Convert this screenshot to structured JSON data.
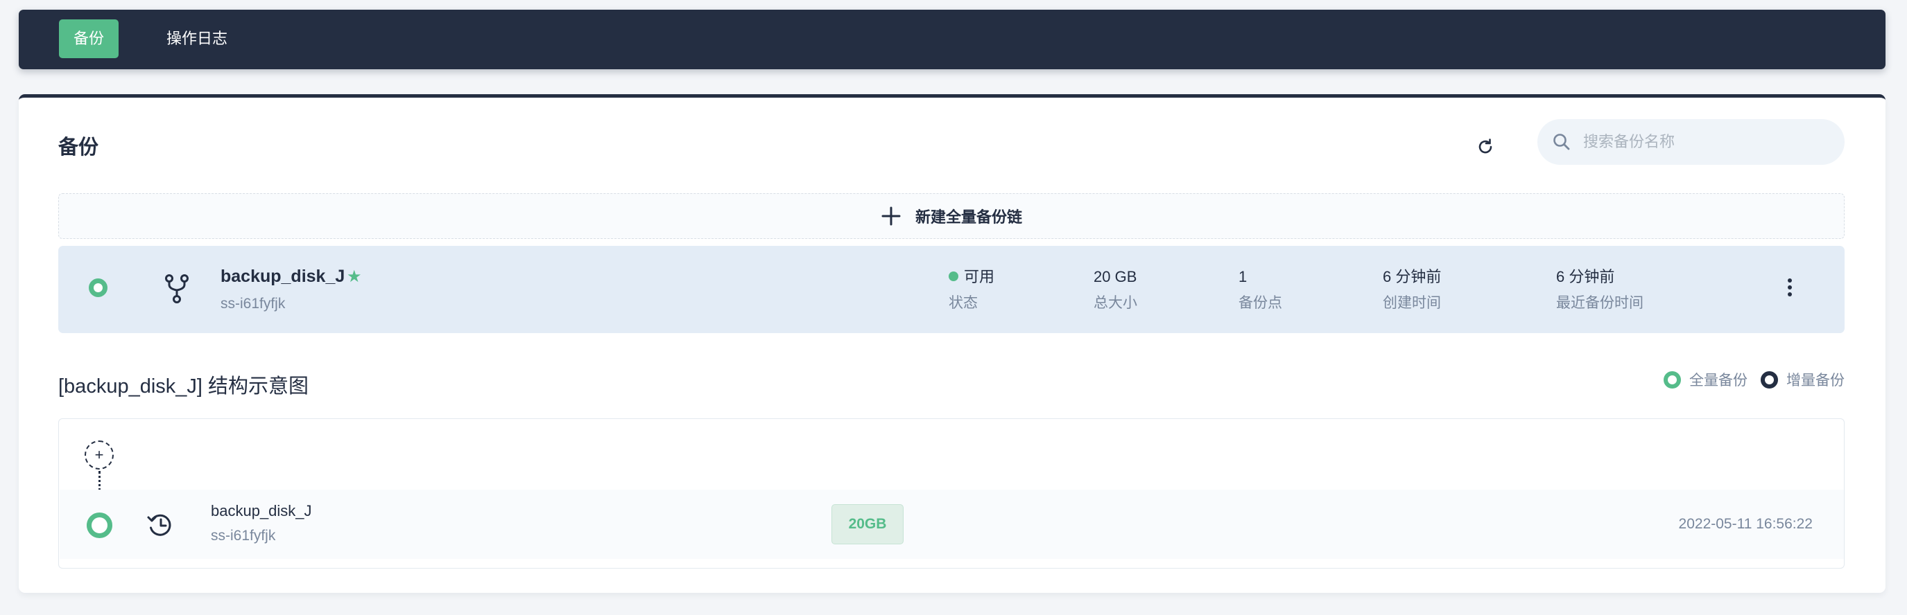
{
  "nav": {
    "tabs": [
      {
        "label": "备份",
        "active": true
      },
      {
        "label": "操作日志",
        "active": false
      }
    ]
  },
  "header": {
    "title": "备份",
    "search_placeholder": "搜索备份名称"
  },
  "new_chain_label": "新建全量备份链",
  "backup": {
    "name": "backup_disk_J",
    "id": "ss-i61fyfjk",
    "status_value": "可用",
    "status_label": "状态",
    "size_value": "20 GB",
    "size_label": "总大小",
    "points_value": "1",
    "points_label": "备份点",
    "created_value": "6 分钟前",
    "created_label": "创建时间",
    "last_value": "6 分钟前",
    "last_label": "最近备份时间"
  },
  "structure": {
    "title": "[backup_disk_J] 结构示意图",
    "legend_full": "全量备份",
    "legend_incremental": "增量备份",
    "add_symbol": "+",
    "node": {
      "name": "backup_disk_J",
      "id": "ss-i61fyfjk",
      "size": "20GB",
      "timestamp": "2022-05-11 16:56:22"
    }
  },
  "colors": {
    "accent_green": "#55bc8a",
    "dark": "#242e42",
    "muted": "#79879c",
    "row_highlight": "#e3ecf6"
  },
  "icons": [
    "refresh-icon",
    "search-icon",
    "plus-icon",
    "branch-icon",
    "star-icon",
    "more-icon",
    "history-icon"
  ]
}
